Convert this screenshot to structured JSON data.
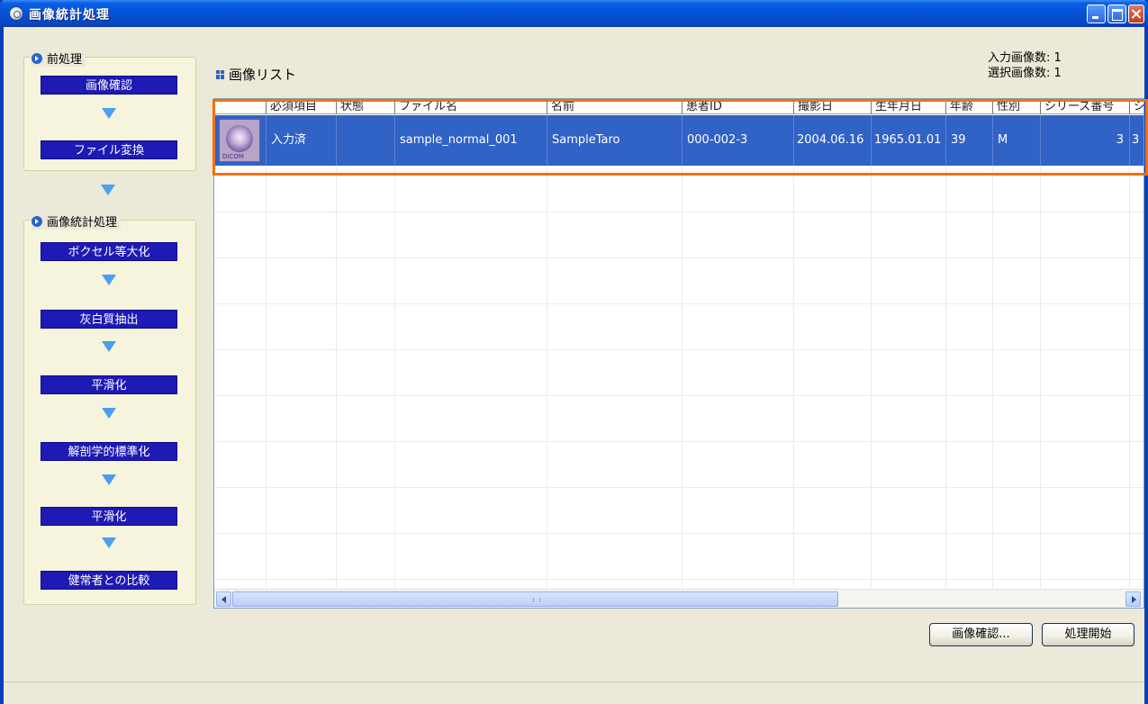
{
  "window": {
    "title": "画像統計処理"
  },
  "sidebar": {
    "preprocess": {
      "title": "前処理",
      "steps": [
        "画像確認",
        "ファイル変換"
      ]
    },
    "statistics": {
      "title": "画像統計処理",
      "steps": [
        "ボクセル等大化",
        "灰白質抽出",
        "平滑化",
        "解剖学的標準化",
        "平滑化",
        "健常者との比較"
      ]
    }
  },
  "main": {
    "list_title": "画像リスト",
    "input_count_label": "入力画像数: 1",
    "selected_count_label": "選択画像数: 1"
  },
  "table": {
    "columns": [
      "",
      "必須項目",
      "状態",
      "ファイル名",
      "名前",
      "患者ID",
      "撮影日",
      "生年月日",
      "年齢",
      "性別",
      "シリーズ番号",
      "シ"
    ],
    "rows": [
      {
        "thumbnail_label": "DICOM",
        "required": "入力済",
        "status": "",
        "file_name": "sample_normal_001",
        "name": "SampleTaro",
        "patient_id": "000-002-3",
        "capture_date": "2004.06.16",
        "birth_date": "1965.01.01",
        "age": "39",
        "sex": "M",
        "series_no": "3",
        "extra": "3"
      }
    ]
  },
  "buttons": {
    "confirm": "画像確認...",
    "start": "処理開始"
  },
  "colors": {
    "step_button": "#1e1ab4",
    "selection": "#3162c6",
    "highlight": "#f2710f",
    "titlebar": "#0652d6"
  }
}
